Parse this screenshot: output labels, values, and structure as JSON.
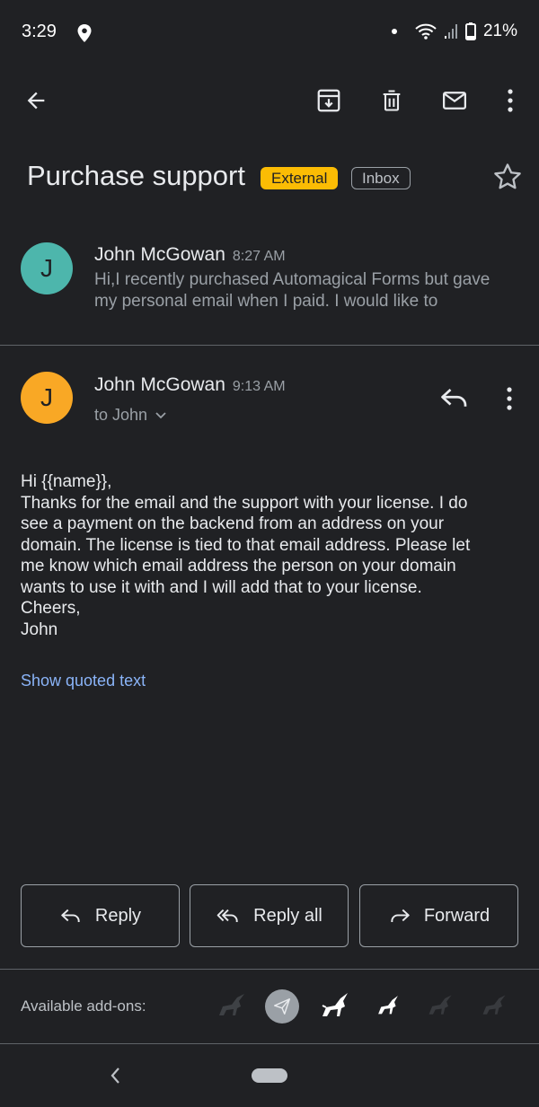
{
  "status_bar": {
    "time": "3:29",
    "battery": "21%",
    "icons": [
      "location-icon",
      "dot-icon",
      "wifi-icon",
      "signal-icon",
      "battery-icon"
    ]
  },
  "toolbar": {
    "icons": [
      "back-arrow-icon",
      "archive-icon",
      "delete-icon",
      "mark-unread-icon",
      "more-vert-icon"
    ]
  },
  "subject": {
    "title": "Purchase support",
    "external_label": "External",
    "inbox_label": "Inbox"
  },
  "messages": [
    {
      "avatar_letter": "J",
      "avatar_color": "#4db6ac",
      "sender": "John McGowan",
      "time": "8:27 AM",
      "snippet": "Hi,I recently purchased Automagical Forms but gave my personal email when I paid. I would like to"
    },
    {
      "avatar_letter": "J",
      "avatar_color": "#f9a825",
      "sender": "John McGowan",
      "time": "9:13 AM",
      "to_line": "to John",
      "body_lines": [
        "Hi {{name}},",
        "Thanks for the email and the support with your license. I do",
        "see a payment on the backend from an address on your",
        "domain. The license is tied to that email address. Please let",
        "me know which email address the person on your domain",
        "wants to use it with and I will add that to your license.",
        "Cheers,",
        "John"
      ],
      "show_quoted_label": "Show quoted text"
    }
  ],
  "actions": {
    "reply_label": "Reply",
    "reply_all_label": "Reply all",
    "forward_label": "Forward"
  },
  "addons": {
    "label": "Available add-ons:",
    "icons": [
      "unicorn-faded-icon",
      "paper-plane-icon",
      "unicorn-icon",
      "unicorn-small-icon",
      "unicorn-faded-icon",
      "unicorn-faded-icon"
    ]
  },
  "colors": {
    "background": "#202124",
    "external_chip": "#fbbc04",
    "link": "#8ab4f8"
  }
}
